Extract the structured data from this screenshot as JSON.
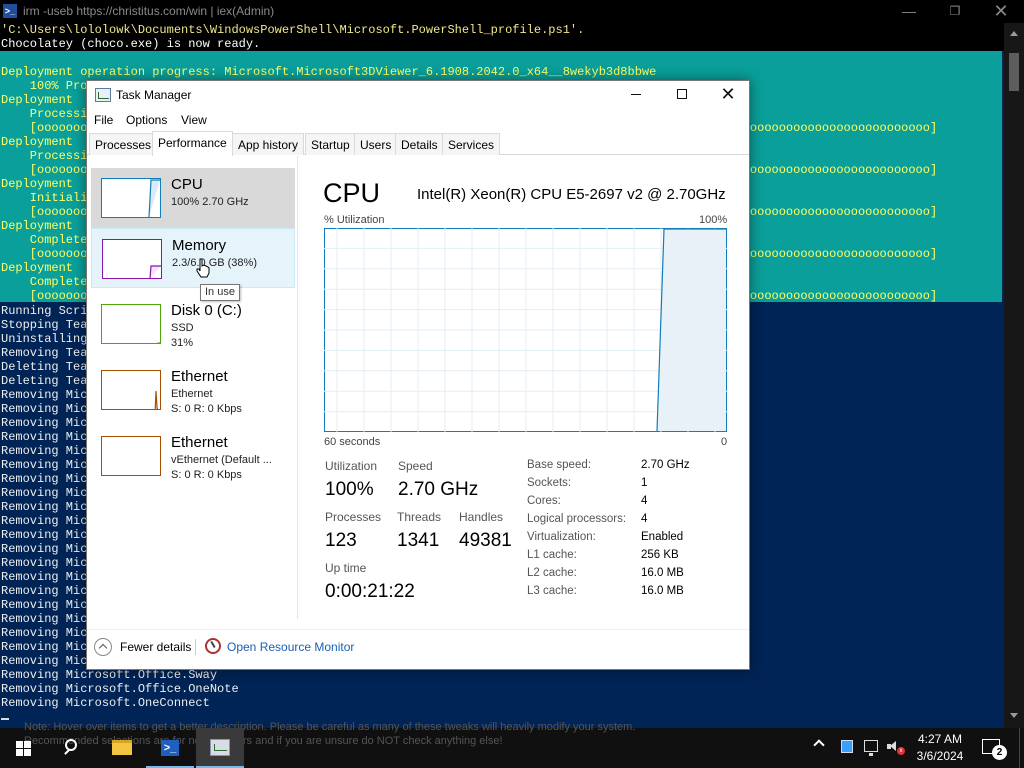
{
  "powershell": {
    "title": "irm -useb https://christitus.com/win | iex(Admin)",
    "top_lines": [
      "'C:\\Users\\lololowk\\Documents\\WindowsPowerShell\\Microsoft.PowerShell_profile.ps1'.",
      "Chocolatey (choco.exe) is now ready."
    ],
    "progress_lines": [
      "Deployment operation progress: Microsoft.Microsoft3DViewer_6.1908.2042.0_x64__8wekyb3d8bbwe",
      "    100% Pro",
      "Deployment",
      "    Processi",
      "    [oooooooo                                                                              oooooooooooooooooooooooooooooooooooooo]",
      "Deployment",
      "    Processi",
      "    [oooooooo                                                                              oooooooooooooooooooooooooooooooooooooo]",
      "Deployment",
      "    Initiali",
      "    [oooooooo                                                                              oooooooooooooooooooooooooooooooooooooo]",
      "Deployment",
      "    Complete",
      "    [oooooooo                                                                              oooooooooooooooooooooooooooooooooooooo]",
      "Deployment",
      "    Complete",
      "    [oooooooo                                                                              oooooooooooooooooooooooooooooooooooooo]"
    ],
    "log_lines": [
      "Running Scri",
      "Stopping Tea",
      "Uninstalling",
      "Removing Tea",
      "Deleting Tea",
      "Deleting Tea",
      "Removing Mic",
      "Removing Mic",
      "Removing Mic",
      "Removing Mic",
      "Removing Mic",
      "Removing Mic",
      "Removing Mic",
      "Removing Mic",
      "Removing Mic",
      "Removing Mic",
      "Removing Mic",
      "Removing Mic",
      "Removing Mic",
      "Removing Mic",
      "Removing Mic",
      "Removing Mic",
      "Removing Mic",
      "Removing Mic",
      "Removing Mic",
      "Removing Mic",
      "Removing Microsoft.Office.Sway",
      "Removing Microsoft.Office.OneNote",
      "Removing Microsoft.OneConnect"
    ],
    "ghost_text_1": "Note: Hover over items to get a better description. Please be careful as many of these tweaks will heavily modify your system.",
    "ghost_text_2": "Recommended selections are for normal users and if you are unsure do NOT check anything else!"
  },
  "task_manager": {
    "title": "Task Manager",
    "menu": [
      "File",
      "Options",
      "View"
    ],
    "tabs": [
      "Processes",
      "Performance",
      "App history",
      "Startup",
      "Users",
      "Details",
      "Services"
    ],
    "active_tab": "Performance",
    "sidebar": [
      {
        "name": "CPU",
        "sub1": "100%  2.70 GHz",
        "sub2": "",
        "color": "#117dbb"
      },
      {
        "name": "Memory",
        "sub1": "2.3/6.0 GB (38%)",
        "sub2": "",
        "color": "#8b12ae"
      },
      {
        "name": "Disk 0 (C:)",
        "sub1": "SSD",
        "sub2": "31%",
        "color": "#4da60c"
      },
      {
        "name": "Ethernet",
        "sub1": "Ethernet",
        "sub2": "S: 0  R: 0 Kbps",
        "color": "#a74f01"
      },
      {
        "name": "Ethernet",
        "sub1": "vEthernet (Default ...",
        "sub2": "S: 0  R: 0 Kbps",
        "color": "#a74f01"
      }
    ],
    "tooltip": "In use",
    "detail": {
      "heading": "CPU",
      "model": "Intel(R) Xeon(R) CPU E5-2697 v2 @ 2.70GHz",
      "utilization_label": "% Utilization",
      "max_label": "100%",
      "time_label": "60 seconds",
      "zero_label": "0",
      "stats": {
        "utilization_label": "Utilization",
        "utilization": "100%",
        "speed_label": "Speed",
        "speed": "2.70 GHz",
        "processes_label": "Processes",
        "processes": "123",
        "threads_label": "Threads",
        "threads": "1341",
        "handles_label": "Handles",
        "handles": "49381",
        "uptime_label": "Up time",
        "uptime": "0:00:21:22"
      },
      "specs": [
        {
          "label": "Base speed:",
          "value": "2.70 GHz"
        },
        {
          "label": "Sockets:",
          "value": "1"
        },
        {
          "label": "Cores:",
          "value": "4"
        },
        {
          "label": "Logical processors:",
          "value": "4"
        },
        {
          "label": "Virtualization:",
          "value": "Enabled"
        },
        {
          "label": "L1 cache:",
          "value": "256 KB"
        },
        {
          "label": "L2 cache:",
          "value": "16.0 MB"
        },
        {
          "label": "L3 cache:",
          "value": "16.0 MB"
        }
      ]
    },
    "footer": {
      "fewer_details": "Fewer details",
      "open_resource_monitor": "Open Resource Monitor"
    }
  },
  "taskbar": {
    "time": "4:27 AM",
    "date": "3/6/2024",
    "notification_count": "2"
  },
  "colors": {
    "ps_background": "#012456",
    "ps_progress_background": "#0a9f9a",
    "ps_progress_text": "#ffff66",
    "cpu_accent": "#117dbb",
    "memory_accent": "#8b12ae",
    "disk_accent": "#4da60c",
    "ethernet_accent": "#a74f01",
    "link_color": "#1a5fb4"
  }
}
